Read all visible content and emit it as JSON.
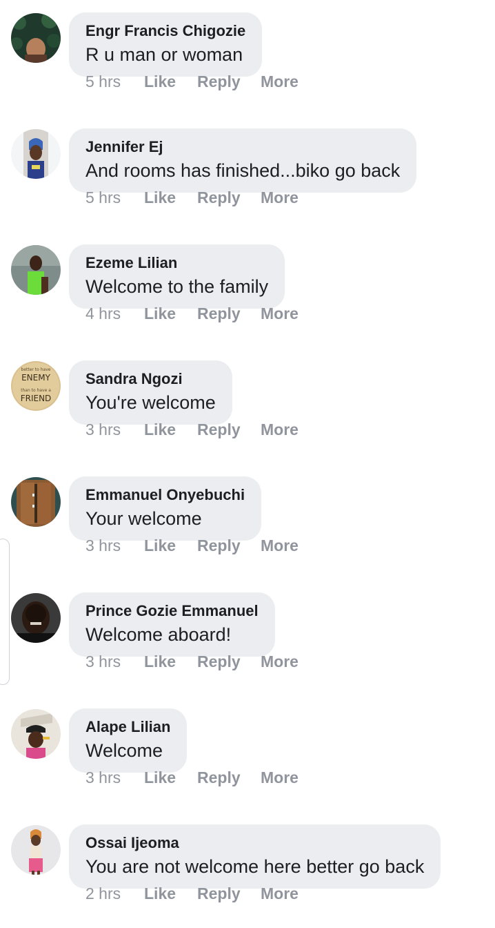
{
  "comments": [
    {
      "author": "Engr Francis Chigozie",
      "text": "R u man or woman",
      "time": "5 hrs",
      "avatar": "person-in-dark-green-foliage"
    },
    {
      "author": "Jennifer Ej",
      "text": "And rooms has finished...biko go back",
      "time": "5 hrs",
      "avatar": "woman-blue-headscarf"
    },
    {
      "author": "Ezeme Lilian",
      "text": "Welcome to the family",
      "time": "4 hrs",
      "avatar": "woman-green-top"
    },
    {
      "author": "Sandra Ngozi",
      "text": "You're welcome",
      "time": "3 hrs",
      "avatar": "enemy-friend-quote-badge"
    },
    {
      "author": "Emmanuel Onyebuchi",
      "text": "Your welcome",
      "time": "3 hrs",
      "avatar": "wooden-door"
    },
    {
      "author": "Prince Gozie Emmanuel",
      "text": "Welcome aboard!",
      "time": "3 hrs",
      "avatar": "man-selfie"
    },
    {
      "author": "Alape Lilian",
      "text": "Welcome",
      "time": "3 hrs",
      "avatar": "woman-cap-pink"
    },
    {
      "author": "Ossai Ijeoma",
      "text": "You are not welcome here better go back",
      "time": "2 hrs",
      "avatar": "woman-standing-pink"
    }
  ],
  "actions": {
    "like": "Like",
    "reply": "Reply",
    "more": "More"
  },
  "avatar_badge_text": [
    "better to have",
    "ENEMY",
    "than to have a",
    "FRIEND"
  ],
  "colors": {
    "bubble": "#ebedf0",
    "author": "#1c1e21",
    "meta": "#90949c"
  }
}
